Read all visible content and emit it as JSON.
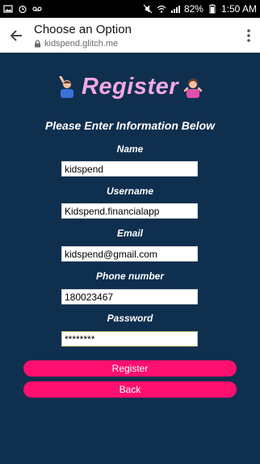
{
  "status_bar": {
    "battery": "82%",
    "time": "1:50 AM"
  },
  "browser": {
    "title": "Choose an Option",
    "url": "kidspend.glitch.me"
  },
  "page": {
    "heading": "Register",
    "subheading": "Please Enter Information Below",
    "fields": [
      {
        "label": "Name",
        "value": "kidspend"
      },
      {
        "label": "Username",
        "value": "Kidspend.financialapp"
      },
      {
        "label": "Email",
        "value": "kidspend@gmail.com"
      },
      {
        "label": "Phone number",
        "value": "180023467"
      },
      {
        "label": "Password",
        "value": "********"
      }
    ],
    "register_button": "Register",
    "back_button": "Back"
  },
  "colors": {
    "background": "#0f2f4f",
    "heading_pink": "#f2a9e2",
    "button_pink": "#ff0f6f"
  }
}
